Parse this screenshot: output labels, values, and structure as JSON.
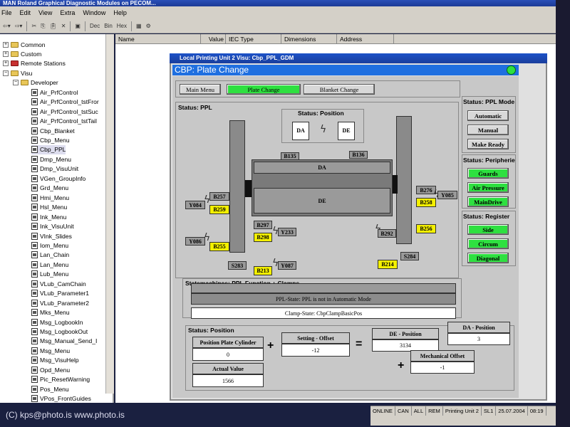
{
  "app": {
    "title": "MAN Roland Graphical Diagnostic Modules on PECOM..."
  },
  "menu": [
    "File",
    "Edit",
    "View",
    "Extra",
    "Window",
    "Help"
  ],
  "toolbar": {
    "dec": "Dec",
    "bin": "Bin",
    "hex": "Hex"
  },
  "tree": {
    "items": [
      {
        "label": "Common",
        "type": "folder",
        "level": 1
      },
      {
        "label": "Custom",
        "type": "folder",
        "level": 1
      },
      {
        "label": "Remote Stations",
        "type": "folder-red",
        "level": 1
      },
      {
        "label": "Visu",
        "type": "folder",
        "level": 1
      },
      {
        "label": "Developer",
        "type": "folder",
        "level": 2
      },
      {
        "label": "Air_PrfControl",
        "type": "doc",
        "level": 3
      },
      {
        "label": "Air_PrfControl_tstFror",
        "type": "doc",
        "level": 3
      },
      {
        "label": "Air_PrfControl_tstSuc",
        "type": "doc",
        "level": 3
      },
      {
        "label": "Air_PrfControl_tstTail",
        "type": "doc",
        "level": 3
      },
      {
        "label": "Cbp_Blanket",
        "type": "doc",
        "level": 3
      },
      {
        "label": "Cbp_Menu",
        "type": "doc",
        "level": 3
      },
      {
        "label": "Cbp_PPL",
        "type": "doc",
        "level": 3
      },
      {
        "label": "Dmp_Menu",
        "type": "doc",
        "level": 3
      },
      {
        "label": "Dmp_VisuUnit",
        "type": "doc",
        "level": 3
      },
      {
        "label": "VGen_GroupInfo",
        "type": "doc",
        "level": 3
      },
      {
        "label": "Grd_Menu",
        "type": "doc",
        "level": 3
      },
      {
        "label": "Hmi_Menu",
        "type": "doc",
        "level": 3
      },
      {
        "label": "Hsl_Menu",
        "type": "doc",
        "level": 3
      },
      {
        "label": "Ink_Menu",
        "type": "doc",
        "level": 3
      },
      {
        "label": "Ink_VisuUnit",
        "type": "doc",
        "level": 3
      },
      {
        "label": "VInk_Slides",
        "type": "doc",
        "level": 3
      },
      {
        "label": "Iom_Menu",
        "type": "doc",
        "level": 3
      },
      {
        "label": "Lan_Chain",
        "type": "doc",
        "level": 3
      },
      {
        "label": "Lan_Menu",
        "type": "doc",
        "level": 3
      },
      {
        "label": "Lub_Menu",
        "type": "doc",
        "level": 3
      },
      {
        "label": "VLub_CamChain",
        "type": "doc",
        "level": 3
      },
      {
        "label": "VLub_Parameter1",
        "type": "doc",
        "level": 3
      },
      {
        "label": "VLub_Parameter2",
        "type": "doc",
        "level": 3
      },
      {
        "label": "Mks_Menu",
        "type": "doc",
        "level": 3
      },
      {
        "label": "Msg_LogbookIn",
        "type": "doc",
        "level": 3
      },
      {
        "label": "Msg_LogbookOut",
        "type": "doc",
        "level": 3
      },
      {
        "label": "Msg_Manual_Send_I",
        "type": "doc",
        "level": 3
      },
      {
        "label": "Msg_Menu",
        "type": "doc",
        "level": 3
      },
      {
        "label": "Msg_VisuHelp",
        "type": "doc",
        "level": 3
      },
      {
        "label": "Opd_Menu",
        "type": "doc",
        "level": 3
      },
      {
        "label": "Pic_ResetWarning",
        "type": "doc",
        "level": 3
      },
      {
        "label": "Pos_Menu",
        "type": "doc",
        "level": 3
      },
      {
        "label": "VPos_FrontGuides",
        "type": "doc",
        "level": 3
      }
    ]
  },
  "columns": [
    "Name",
    "Value",
    "IEC Type",
    "Dimensions",
    "Address"
  ],
  "child": {
    "title": "Local Printing Unit 2 Visu: Cbp_PPL_GDM",
    "header": "CBP: Plate Change"
  },
  "tabs": {
    "main": "Main Menu",
    "plate": "Plate Change",
    "blanket": "Blanket Change"
  },
  "status_ppl": {
    "title": "Status: PPL",
    "position_title": "Status: Position",
    "pos_da": "DA",
    "pos_de": "DE",
    "cyl_da": "DA",
    "cyl_de": "DE",
    "labels": {
      "b135": "B135",
      "b136": "B136",
      "b257": "B257",
      "b259": "B259",
      "y084": "Y084",
      "y086": "Y086",
      "b255": "B255",
      "b297": "B297",
      "b298": "B298",
      "y233": "Y233",
      "s283": "S283",
      "b213": "B213",
      "y087": "Y087",
      "b292": "B292",
      "b256": "B256",
      "s284": "S284",
      "b214": "B214",
      "b276": "B276",
      "y085": "Y085",
      "b258": "B258"
    }
  },
  "ppl_mode": {
    "title": "Status: PPL Mode",
    "automatic": "Automatic",
    "manual": "Manual",
    "make_ready": "Make Ready"
  },
  "peripherie": {
    "title": "Status: Peripherie",
    "guards": "Guards",
    "air": "Air Pressure",
    "maindrive": "MainDrive"
  },
  "register": {
    "title": "Status: Register",
    "side": "Side",
    "circum": "Circum",
    "diagonal": "Diagonal"
  },
  "statemachines": {
    "title": "Statemachines: PPL Function + Clamps",
    "ppl_state": "PPL-State:   PPL is not in Automatic Mode",
    "clamp_state": "Clamp-State:   CbpClampBasicPos"
  },
  "position": {
    "title": "Status: Position",
    "plate_cyl_label": "Position Plate Cylinder",
    "plate_cyl_value": "0",
    "setting_label": "Setting - Offset",
    "setting_value": "-12",
    "de_label": "DE - Position",
    "de_value": "3134",
    "da_label": "DA - Position",
    "da_value": "3",
    "actual_label": "Actual Value",
    "actual_value": "1566",
    "mech_label": "Mechanical Offset",
    "mech_value": "-1",
    "plus1": "+",
    "eq": "=",
    "plus2": "+"
  },
  "statusbar": [
    "ONLINE",
    "CAN",
    "ALL",
    "REM",
    "Printing Unit 2",
    "SL1",
    "25.07.2004",
    "08:19"
  ],
  "credit": "(C) kps@photo.is  www.photo.is",
  "colors": {
    "green": "#2ee040",
    "yellow": "#f4f000",
    "header_blue": "#1f6fe0"
  }
}
